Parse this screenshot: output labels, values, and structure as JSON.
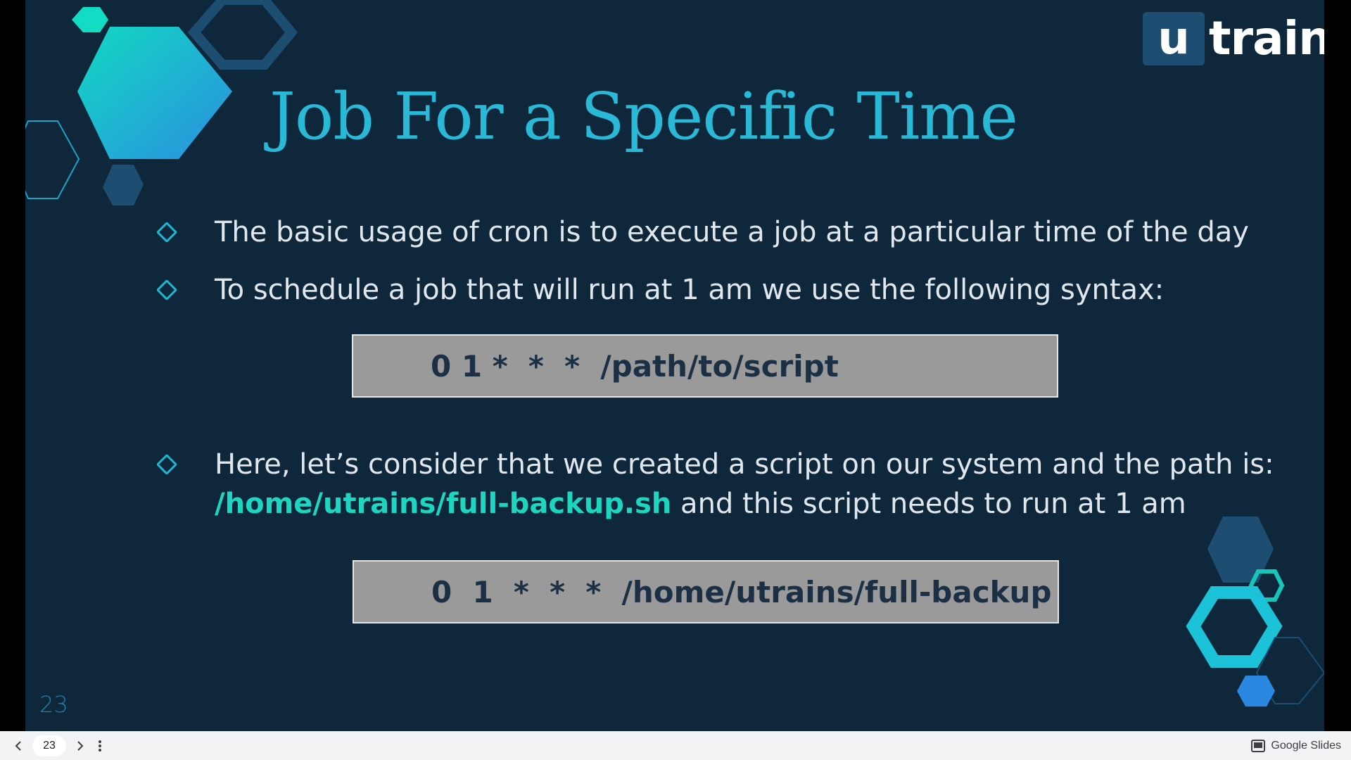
{
  "slide": {
    "title": "Job For a Specific Time",
    "bullets": [
      "The basic usage of cron is to execute a job at a particular time of the day",
      "To schedule a job that will run at 1 am we use the following syntax:"
    ],
    "code_1": "0 1 *  *  *  /path/to/script",
    "bullet_3": {
      "line_1": "Here, let’s consider that we created a script on our system and the path is:",
      "path": "/home/utrains/full-backup.sh",
      "line_2_rest": " and this script needs to run at 1 am"
    },
    "code_2": "0  1  *  *  *  /home/utrains/full-backup",
    "slide_number": "23",
    "logo": {
      "box_letter": "u",
      "word": "train"
    },
    "colors": {
      "background": "#0f273b",
      "title": "#29b8d6",
      "highlight": "#1dd6bf",
      "code_bg": "#9a9a9a"
    }
  },
  "viewer": {
    "prev_icon": "chevron-left-icon",
    "page": "23",
    "next_icon": "chevron-right-icon",
    "menu_icon": "more-vert-icon",
    "brand_label": "Google Slides"
  }
}
